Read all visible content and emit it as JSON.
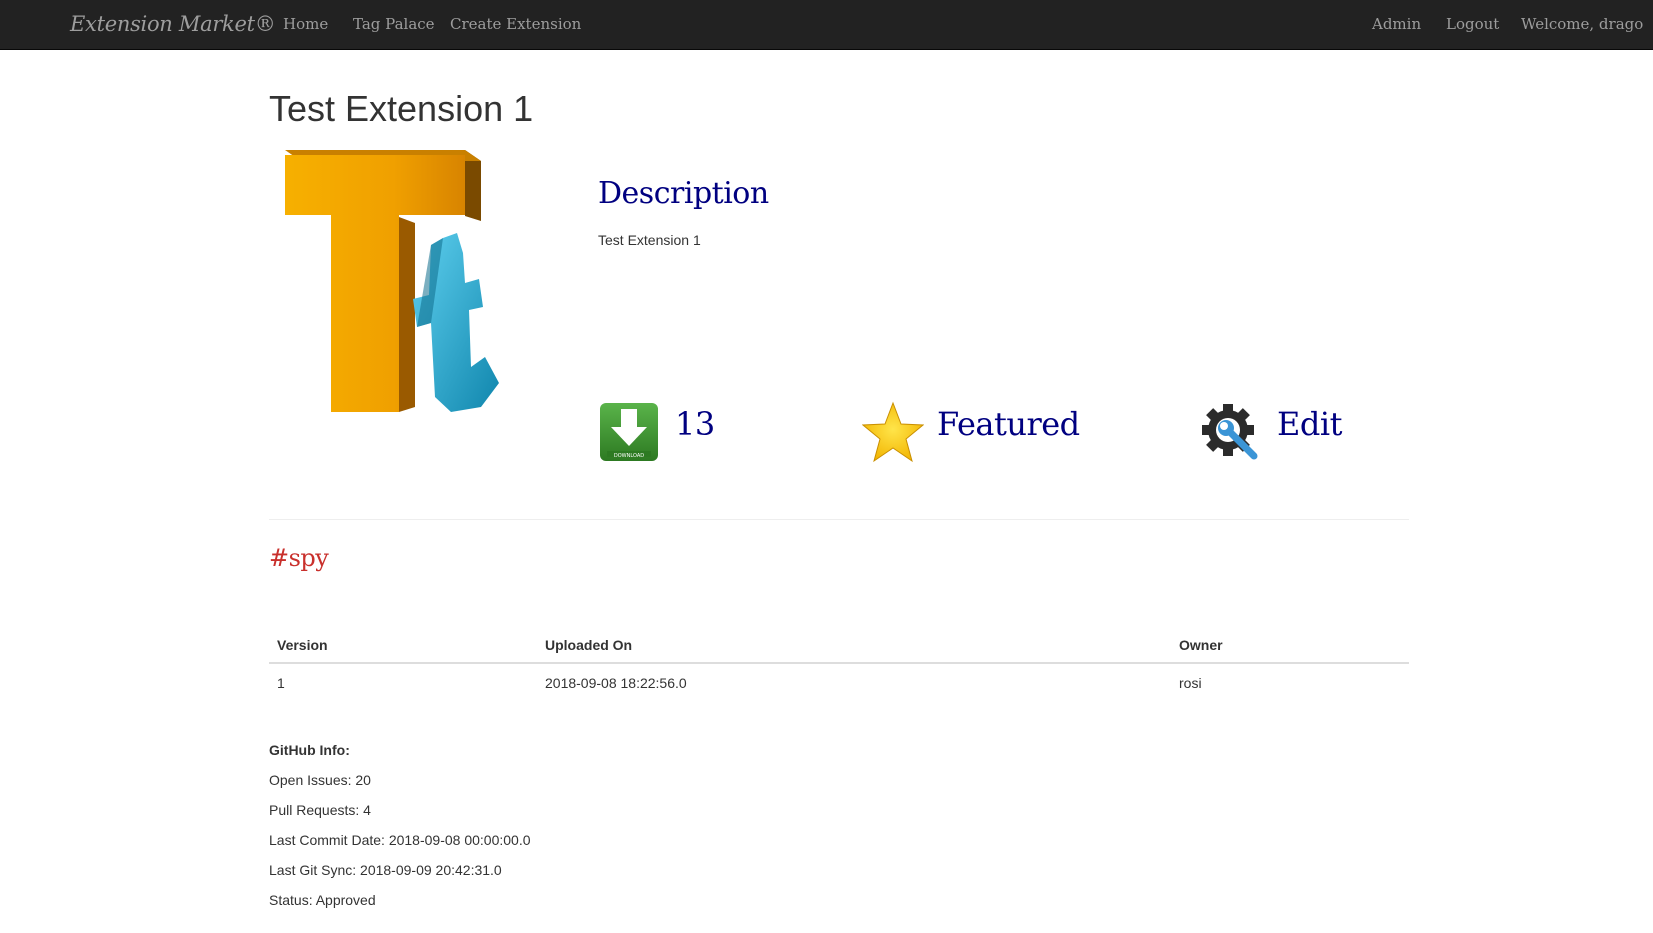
{
  "navbar": {
    "brand": "Extension Market®",
    "links": [
      "Home",
      "Tag Palace",
      "Create Extension"
    ],
    "admin": "Admin",
    "logout": "Logout",
    "welcome": "Welcome, drago",
    "background": "#222222"
  },
  "extension": {
    "title": "Test Extension 1",
    "logo_icon": "tt-3d-logo-icon",
    "description_heading": "Description",
    "description": "Test Extension 1",
    "downloads": "13",
    "featured_label": "Featured",
    "edit_label": "Edit",
    "tag": "#spy"
  },
  "versions_table": {
    "columns": [
      "Version",
      "Uploaded On",
      "Owner"
    ],
    "rows": [
      [
        "1",
        "2018-09-08 18:22:56.0",
        "rosi"
      ]
    ]
  },
  "github": {
    "heading": "GitHub Info:",
    "open_issues": "Open Issues: 20",
    "pull_requests": "Pull Requests: 4",
    "last_commit": "Last Commit Date: 2018-09-08 00:00:00.0",
    "last_sync": "Last Git Sync: 2018-09-09 20:42:31.0",
    "status": "Status: Approved"
  },
  "colors": {
    "heading_navy": "#000080",
    "tag_red": "#c9302c",
    "logo_orange": "#f0a000",
    "logo_blue": "#1fa3c9"
  }
}
